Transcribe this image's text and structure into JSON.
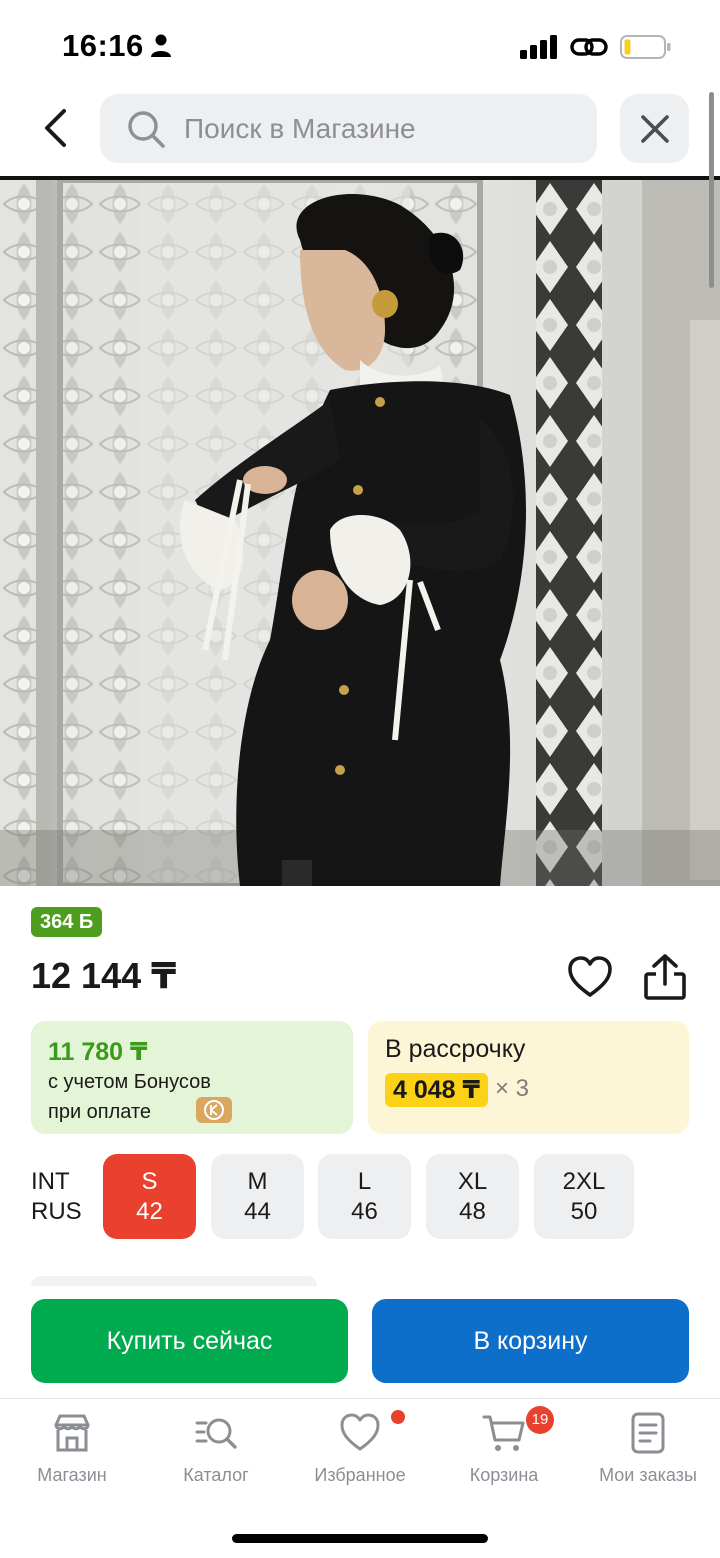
{
  "status_bar": {
    "time": "16:16"
  },
  "search": {
    "placeholder": "Поиск в Магазине"
  },
  "product": {
    "bonus_badge": "364 Б",
    "price": "12 144 ₸",
    "bonus_card": {
      "price": "11 780 ₸",
      "note_line1": "с учетом Бонусов",
      "note_line2": "при оплате"
    },
    "installment_card": {
      "title": "В рассрочку",
      "amount": "4 048 ₸",
      "times": "× 3"
    }
  },
  "sizes": {
    "label_int": "INT",
    "label_rus": "RUS",
    "options": [
      {
        "int": "S",
        "rus": "42",
        "selected": true
      },
      {
        "int": "M",
        "rus": "44",
        "selected": false
      },
      {
        "int": "L",
        "rus": "46",
        "selected": false
      },
      {
        "int": "XL",
        "rus": "48",
        "selected": false
      },
      {
        "int": "2XL",
        "rus": "50",
        "selected": false
      }
    ]
  },
  "actions": {
    "buy_now": "Купить сейчас",
    "add_to_cart": "В корзину"
  },
  "tab_bar": {
    "items": [
      {
        "label": "Магазин",
        "icon": "store-icon"
      },
      {
        "label": "Каталог",
        "icon": "catalog-search-icon"
      },
      {
        "label": "Избранное",
        "icon": "heart-icon"
      },
      {
        "label": "Корзина",
        "icon": "cart-icon"
      },
      {
        "label": "Мои заказы",
        "icon": "orders-icon"
      }
    ],
    "cart_badge": "19"
  },
  "colors": {
    "buy_button": "#00ab4f",
    "cart_button": "#0d6fc9",
    "selected_size": "#e9412d",
    "bonus_green": "#4f9d1e",
    "installment_highlight": "#fcd116"
  }
}
